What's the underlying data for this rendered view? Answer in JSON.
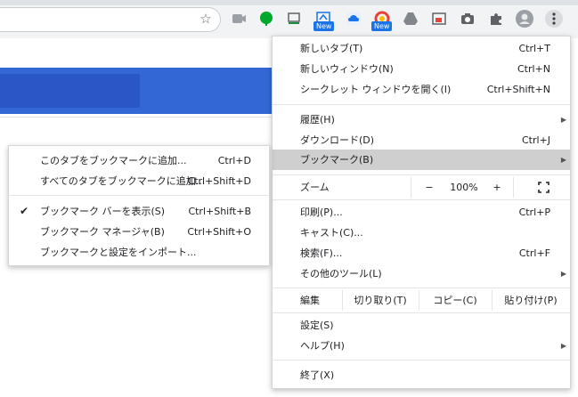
{
  "toolbar": {
    "star_icon": "star-icon",
    "extensions": [
      {
        "name": "meet-icon",
        "color": "#5f6368"
      },
      {
        "name": "evernote-icon",
        "color": "#00a82d"
      },
      {
        "name": "monitor-icon",
        "color": "#5f6368"
      },
      {
        "name": "screencast-icon",
        "color": "#1a73e8"
      },
      {
        "name": "cloud-icon",
        "color": "#1a73e8"
      },
      {
        "name": "color-picker-icon",
        "color": "#e94235"
      },
      {
        "name": "drive-icon",
        "color": "#5f6368"
      },
      {
        "name": "gallery-icon",
        "color": "#5f6368"
      },
      {
        "name": "camera-icon",
        "color": "#5f6368"
      },
      {
        "name": "puzzle-icon",
        "color": "#5f6368"
      },
      {
        "name": "avatar-icon",
        "color": "#9aa0a6"
      },
      {
        "name": "kebab-menu-icon",
        "color": "#5f6368"
      }
    ],
    "badge_new": "New"
  },
  "main_menu": {
    "new_tab": {
      "label": "新しいタブ(T)",
      "shortcut": "Ctrl+T"
    },
    "new_window": {
      "label": "新しいウィンドウ(N)",
      "shortcut": "Ctrl+N"
    },
    "incognito": {
      "label": "シークレット ウィンドウを開く(I)",
      "shortcut": "Ctrl+Shift+N"
    },
    "history": {
      "label": "履歴(H)"
    },
    "downloads": {
      "label": "ダウンロード(D)",
      "shortcut": "Ctrl+J"
    },
    "bookmarks": {
      "label": "ブックマーク(B)"
    },
    "zoom": {
      "label": "ズーム",
      "minus": "−",
      "value": "100%",
      "plus": "+"
    },
    "print": {
      "label": "印刷(P)...",
      "shortcut": "Ctrl+P"
    },
    "cast": {
      "label": "キャスト(C)..."
    },
    "find": {
      "label": "検索(F)...",
      "shortcut": "Ctrl+F"
    },
    "more_tools": {
      "label": "その他のツール(L)"
    },
    "edit": {
      "label": "編集",
      "cut": "切り取り(T)",
      "copy": "コピー(C)",
      "paste": "貼り付け(P)"
    },
    "settings": {
      "label": "設定(S)"
    },
    "help": {
      "label": "ヘルプ(H)"
    },
    "exit": {
      "label": "終了(X)"
    }
  },
  "bookmark_menu": {
    "add_tab": {
      "label": "このタブをブックマークに追加...",
      "shortcut": "Ctrl+D"
    },
    "add_all": {
      "label": "すべてのタブをブックマークに追加...",
      "shortcut": "Ctrl+Shift+D"
    },
    "show_bar": {
      "label": "ブックマーク バーを表示(S)",
      "shortcut": "Ctrl+Shift+B",
      "checked": true
    },
    "manager": {
      "label": "ブックマーク マネージャ(B)",
      "shortcut": "Ctrl+Shift+O"
    },
    "import": {
      "label": "ブックマークと設定をインポート..."
    }
  }
}
